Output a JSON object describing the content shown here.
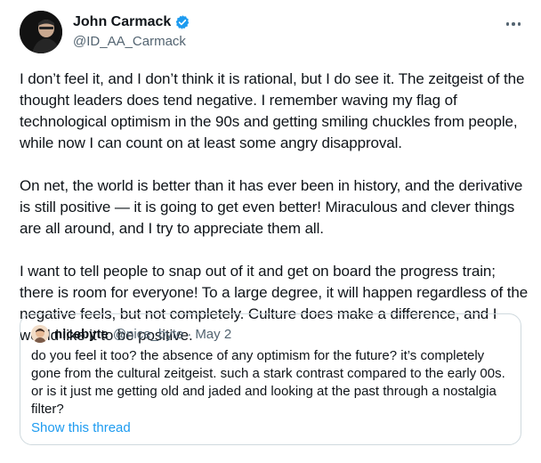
{
  "author": {
    "display_name": "John Carmack",
    "handle": "@ID_AA_Carmack",
    "avatar_icon": "user-avatar-photo",
    "verified_icon": "verified-badge-icon",
    "verified_color": "#1d9bf0"
  },
  "menu": {
    "more_icon": "more-horizontal-icon"
  },
  "tweet": {
    "paragraphs": [
      "I don’t feel it, and I don’t think it is rational, but I do see it. The zeitgeist of the thought leaders does tend negative. I remember waving my flag of technological optimism in the 90s and getting smiling chuckles from people, while now I can count on at least some angry disapproval.",
      "On net, the world is better than it has ever been in history, and the derivative is still positive — it is going to get even better! Miraculous and clever things are all around, and I try to appreciate them all.",
      "I want to tell people to snap out of it and get on board the progress train; there is room for everyone! To a large degree, it will happen regardless of the negative feels, but not completely. Culture does make a difference, and I would like it to be positive."
    ]
  },
  "quote": {
    "display_name": "nicebyte",
    "handle": "@nice_byte",
    "separator": "·",
    "date": "May 2",
    "text": "do you feel it too? the absence of any optimism for the future? it’s completely gone from the cultural zeitgeist. such a stark contrast compared to the early 00s. or is it just me getting old and jaded and looking at the past through a nostalgia filter?",
    "show_thread": "Show this thread",
    "link_color": "#1d9bf0"
  }
}
